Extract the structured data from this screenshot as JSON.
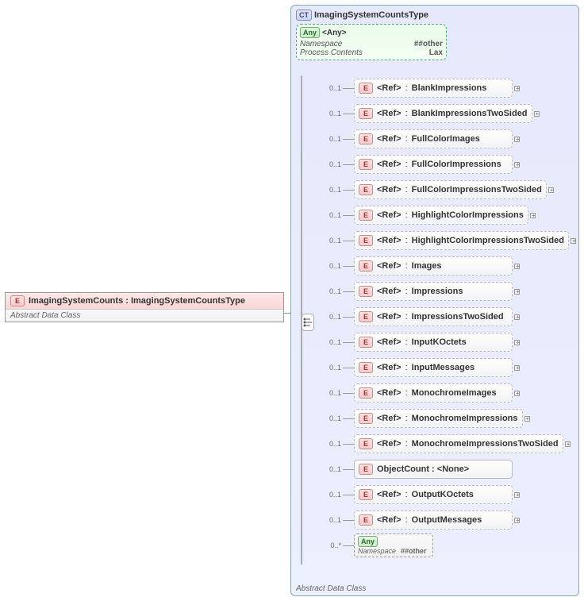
{
  "root": {
    "badge": "E",
    "title": "ImagingSystemCounts : ImagingSystemCountsType",
    "subtitle": "Abstract Data Class"
  },
  "ct": {
    "badge": "CT",
    "title": "ImagingSystemCountsType",
    "footer": "Abstract Data Class"
  },
  "anyTop": {
    "badge": "Any",
    "label": "<Any>",
    "rows": [
      {
        "k": "Namespace",
        "v": "##other"
      },
      {
        "k": "Process Contents",
        "v": "Lax"
      }
    ]
  },
  "seqCard": "0..1",
  "seqCardMany": "0..*",
  "children": [
    {
      "type": "ref",
      "name": "BlankImpressions",
      "card": "0..1"
    },
    {
      "type": "ref",
      "name": "BlankImpressionsTwoSided",
      "card": "0..1"
    },
    {
      "type": "ref",
      "name": "FullColorImages",
      "card": "0..1"
    },
    {
      "type": "ref",
      "name": "FullColorImpressions",
      "card": "0..1"
    },
    {
      "type": "ref",
      "name": "FullColorImpressionsTwoSided",
      "card": "0..1"
    },
    {
      "type": "ref",
      "name": "HighlightColorImpressions",
      "card": "0..1"
    },
    {
      "type": "ref",
      "name": "HighlightColorImpressionsTwoSided",
      "card": "0..1"
    },
    {
      "type": "ref",
      "name": "Images",
      "card": "0..1"
    },
    {
      "type": "ref",
      "name": "Impressions",
      "card": "0..1"
    },
    {
      "type": "ref",
      "name": "ImpressionsTwoSided",
      "card": "0..1"
    },
    {
      "type": "ref",
      "name": "InputKOctets",
      "card": "0..1"
    },
    {
      "type": "ref",
      "name": "InputMessages",
      "card": "0..1"
    },
    {
      "type": "ref",
      "name": "MonochromeImages",
      "card": "0..1"
    },
    {
      "type": "ref",
      "name": "MonochromeImpressions",
      "card": "0..1"
    },
    {
      "type": "ref",
      "name": "MonochromeImpressionsTwoSided",
      "card": "0..1"
    },
    {
      "type": "obj",
      "name": "ObjectCount : <None>",
      "card": "0..1"
    },
    {
      "type": "ref",
      "name": "OutputKOctets",
      "card": "0..1"
    },
    {
      "type": "ref",
      "name": "OutputMessages",
      "card": "0..1"
    },
    {
      "type": "any",
      "card": "0..*",
      "label": "<Any>",
      "ns": "##other"
    }
  ],
  "refWord": "<Ref>",
  "anyWord": "<Any>",
  "nsWord": "Namespace"
}
